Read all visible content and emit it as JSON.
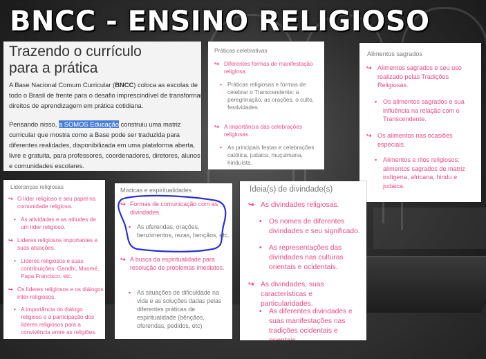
{
  "title": "BNCC - ENSINO RELIGIOSO",
  "intro": {
    "heading_line1": "Trazendo o currículo",
    "heading_line2": "para a prática",
    "p1_before": "A Base Nacional Comum Curricular (",
    "p1_bold": "BNCC",
    "p1_after": ") coloca as escolas de todo o Brasil de frente para o desafio imprescindível de transformar direitos de aprendizagem em prática cotidiana.",
    "p2_before": "Pensando nisso, ",
    "p2_highlight": "a SOMOS Educação",
    "p2_after": " construiu uma matriz curricular que mostra como a Base pode ser traduzida para diferentes realidades, disponibilizada em uma plataforma aberta, livre e gratuita, para professores, coordenadores, diretores, alunos e comunidades escolares."
  },
  "praticas": {
    "heading": "Práticas celebrativas",
    "items": [
      "Diferentes formas de manifestação religiosa.",
      "Práticas religiosas e formas de celebrar o Transcendente: a peregrinação, as orações, o culto, festividades.",
      "A importância das celebrações religiosas.",
      "As principais festas e celebrações católica, judaica, muçulmana, hinduísta."
    ]
  },
  "alimentos": {
    "heading": "Alimentos sagrados",
    "items": [
      "Alimentos sagrados e seu uso realizado pelas Tradições Religiosas.",
      "Os alimentos sagrados e sua influência na relação com o Transcendente.",
      "Os alimentos nas ocasiões especiais.",
      "Alimentos e ritos religiosos: alimentos sagrados de matriz indígena, africana, hindu e judaica."
    ]
  },
  "liderancas": {
    "heading": "Lideranças religiosas",
    "items": [
      "O líder religioso e seu papel na comunidade religiosa.",
      "As atividades e as atitudes de um líder religioso.",
      "Líderes religiosos importantes e suas atuações.",
      "Líderes religiosos e suas contribuições: Gandhi, Maomé, Papa Francisco, etc.",
      "Os líderes religiosos e os diálogos inter-religiosos.",
      "A importância do diálogo religioso e a participação dos líderes religiosos para a convivência entre as religiões."
    ]
  },
  "misticas": {
    "heading": "Místicas e espiritualidades",
    "items": [
      "Formas de comunicação com as divindades.",
      "As oferendas, orações, benzimentos, rezas, bençãos, etc.",
      "A busca da espiritualidade para resolução de problemas imediatos.",
      "As situações de dificuldade na vida e as soluções dadas pelas diferentes práticas de espiritualidade (bênçãos, oferendas, pedidos, etc)"
    ]
  },
  "ideias": {
    "heading": "Ideia(s) de divindade(s)",
    "items": [
      "As divindades religiosas.",
      "Os nomes de diferentes divindades e seu significado.",
      "As representações das divindades nas culturas orientais e ocidentais.",
      "As divindades, suas características e particularidades.",
      "As diferentes divindades e suas manifestações nas tradições ocidentais e orientais."
    ]
  },
  "glyphs": {
    "arrow": "↪",
    "bullet": "•"
  },
  "colors": {
    "accent": "#ea4a86",
    "annotation": "#2b2fd1"
  }
}
